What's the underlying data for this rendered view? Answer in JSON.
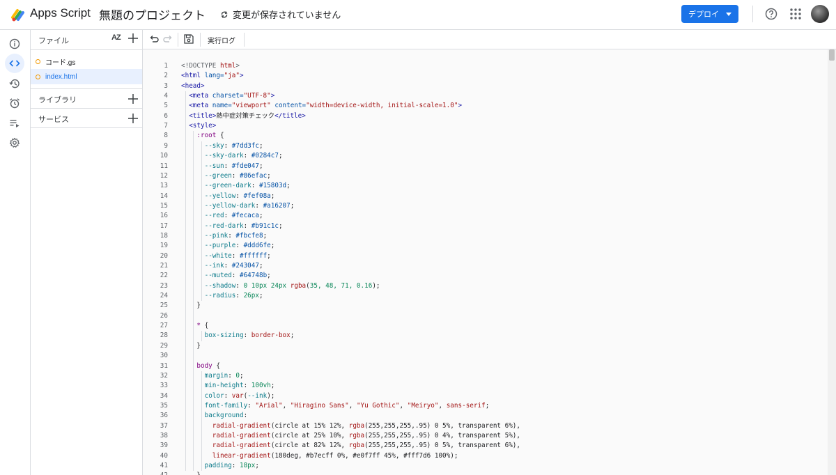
{
  "header": {
    "app_title": "Apps Script",
    "project_title": "無題のプロジェクト",
    "save_status": "変更が保存されていません",
    "deploy_label": "デプロイ"
  },
  "files_panel": {
    "title": "ファイル",
    "sort_label": "AZ",
    "files": [
      {
        "name": "コード.gs",
        "active": false
      },
      {
        "name": "index.html",
        "active": true
      }
    ],
    "sections": [
      {
        "label": "ライブラリ"
      },
      {
        "label": "サービス"
      }
    ]
  },
  "toolbar": {
    "run_log_label": "実行ログ"
  },
  "editor": {
    "lines": [
      {
        "n": "1",
        "indent": 0,
        "tokens": [
          [
            "t-gray",
            "<!DOCTYPE "
          ],
          [
            "t-str",
            "html"
          ],
          [
            "t-gray",
            ">"
          ]
        ]
      },
      {
        "n": "2",
        "indent": 0,
        "tokens": [
          [
            "t-tag",
            "<html "
          ],
          [
            "t-attr",
            "lang="
          ],
          [
            "t-str",
            "\"ja\""
          ],
          [
            "t-tag",
            ">"
          ]
        ]
      },
      {
        "n": "3",
        "indent": 0,
        "tokens": [
          [
            "t-tag",
            "<head>"
          ]
        ]
      },
      {
        "n": "4",
        "indent": 1,
        "tokens": [
          [
            "t-tag",
            "<meta "
          ],
          [
            "t-attr",
            "charset="
          ],
          [
            "t-str",
            "\"UTF-8\""
          ],
          [
            "t-tag",
            ">"
          ]
        ]
      },
      {
        "n": "5",
        "indent": 1,
        "tokens": [
          [
            "t-tag",
            "<meta "
          ],
          [
            "t-attr",
            "name="
          ],
          [
            "t-str",
            "\"viewport\""
          ],
          [
            "t-attr",
            " content="
          ],
          [
            "t-str",
            "\"width=device-width, initial-scale=1.0\""
          ],
          [
            "t-tag",
            ">"
          ]
        ]
      },
      {
        "n": "6",
        "indent": 1,
        "tokens": [
          [
            "t-tag",
            "<title>"
          ],
          [
            "",
            "熱中症対策チェック"
          ],
          [
            "t-tag",
            "</title>"
          ]
        ]
      },
      {
        "n": "7",
        "indent": 1,
        "tokens": [
          [
            "t-tag",
            "<style>"
          ]
        ]
      },
      {
        "n": "8",
        "indent": 2,
        "tokens": [
          [
            "t-sel",
            ":root "
          ],
          [
            "",
            "{"
          ]
        ]
      },
      {
        "n": "9",
        "indent": 3,
        "tokens": [
          [
            "t-prop",
            "--sky"
          ],
          [
            "",
            ": "
          ],
          [
            "t-attr",
            "#7dd3fc"
          ],
          [
            "",
            ";"
          ]
        ]
      },
      {
        "n": "10",
        "indent": 3,
        "tokens": [
          [
            "t-prop",
            "--sky-dark"
          ],
          [
            "",
            ": "
          ],
          [
            "t-attr",
            "#0284c7"
          ],
          [
            "",
            ";"
          ]
        ]
      },
      {
        "n": "11",
        "indent": 3,
        "tokens": [
          [
            "t-prop",
            "--sun"
          ],
          [
            "",
            ": "
          ],
          [
            "t-attr",
            "#fde047"
          ],
          [
            "",
            ";"
          ]
        ]
      },
      {
        "n": "12",
        "indent": 3,
        "tokens": [
          [
            "t-prop",
            "--green"
          ],
          [
            "",
            ": "
          ],
          [
            "t-attr",
            "#86efac"
          ],
          [
            "",
            ";"
          ]
        ]
      },
      {
        "n": "13",
        "indent": 3,
        "tokens": [
          [
            "t-prop",
            "--green-dark"
          ],
          [
            "",
            ": "
          ],
          [
            "t-attr",
            "#15803d"
          ],
          [
            "",
            ";"
          ]
        ]
      },
      {
        "n": "14",
        "indent": 3,
        "tokens": [
          [
            "t-prop",
            "--yellow"
          ],
          [
            "",
            ": "
          ],
          [
            "t-attr",
            "#fef08a"
          ],
          [
            "",
            ";"
          ]
        ]
      },
      {
        "n": "15",
        "indent": 3,
        "tokens": [
          [
            "t-prop",
            "--yellow-dark"
          ],
          [
            "",
            ": "
          ],
          [
            "t-attr",
            "#a16207"
          ],
          [
            "",
            ";"
          ]
        ]
      },
      {
        "n": "16",
        "indent": 3,
        "tokens": [
          [
            "t-prop",
            "--red"
          ],
          [
            "",
            ": "
          ],
          [
            "t-attr",
            "#fecaca"
          ],
          [
            "",
            ";"
          ]
        ]
      },
      {
        "n": "17",
        "indent": 3,
        "tokens": [
          [
            "t-prop",
            "--red-dark"
          ],
          [
            "",
            ": "
          ],
          [
            "t-attr",
            "#b91c1c"
          ],
          [
            "",
            ";"
          ]
        ]
      },
      {
        "n": "18",
        "indent": 3,
        "tokens": [
          [
            "t-prop",
            "--pink"
          ],
          [
            "",
            ": "
          ],
          [
            "t-attr",
            "#fbcfe8"
          ],
          [
            "",
            ";"
          ]
        ]
      },
      {
        "n": "19",
        "indent": 3,
        "tokens": [
          [
            "t-prop",
            "--purple"
          ],
          [
            "",
            ": "
          ],
          [
            "t-attr",
            "#ddd6fe"
          ],
          [
            "",
            ";"
          ]
        ]
      },
      {
        "n": "20",
        "indent": 3,
        "tokens": [
          [
            "t-prop",
            "--white"
          ],
          [
            "",
            ": "
          ],
          [
            "t-attr",
            "#ffffff"
          ],
          [
            "",
            ";"
          ]
        ]
      },
      {
        "n": "21",
        "indent": 3,
        "tokens": [
          [
            "t-prop",
            "--ink"
          ],
          [
            "",
            ": "
          ],
          [
            "t-attr",
            "#243047"
          ],
          [
            "",
            ";"
          ]
        ]
      },
      {
        "n": "22",
        "indent": 3,
        "tokens": [
          [
            "t-prop",
            "--muted"
          ],
          [
            "",
            ": "
          ],
          [
            "t-attr",
            "#64748b"
          ],
          [
            "",
            ";"
          ]
        ]
      },
      {
        "n": "23",
        "indent": 3,
        "tokens": [
          [
            "t-prop",
            "--shadow"
          ],
          [
            "",
            ": "
          ],
          [
            "t-num",
            "0 10px 24px "
          ],
          [
            "t-str",
            "rgba"
          ],
          [
            "",
            "("
          ],
          [
            "t-num",
            "35, 48, 71, 0.16"
          ],
          [
            "",
            ");"
          ]
        ]
      },
      {
        "n": "24",
        "indent": 3,
        "tokens": [
          [
            "t-prop",
            "--radius"
          ],
          [
            "",
            ": "
          ],
          [
            "t-num",
            "26px"
          ],
          [
            "",
            ";"
          ]
        ]
      },
      {
        "n": "25",
        "indent": 2,
        "tokens": [
          [
            "",
            "}"
          ]
        ]
      },
      {
        "n": "26",
        "indent": 0,
        "tokens": []
      },
      {
        "n": "27",
        "indent": 2,
        "tokens": [
          [
            "t-sel",
            "* "
          ],
          [
            "",
            "{"
          ]
        ]
      },
      {
        "n": "28",
        "indent": 3,
        "tokens": [
          [
            "t-prop",
            "box-sizing"
          ],
          [
            "",
            ": "
          ],
          [
            "t-str",
            "border-box"
          ],
          [
            "",
            ";"
          ]
        ]
      },
      {
        "n": "29",
        "indent": 2,
        "tokens": [
          [
            "",
            "}"
          ]
        ]
      },
      {
        "n": "30",
        "indent": 0,
        "tokens": []
      },
      {
        "n": "31",
        "indent": 2,
        "tokens": [
          [
            "t-sel",
            "body "
          ],
          [
            "",
            "{"
          ]
        ]
      },
      {
        "n": "32",
        "indent": 3,
        "tokens": [
          [
            "t-prop",
            "margin"
          ],
          [
            "",
            ": "
          ],
          [
            "t-num",
            "0"
          ],
          [
            "",
            ";"
          ]
        ]
      },
      {
        "n": "33",
        "indent": 3,
        "tokens": [
          [
            "t-prop",
            "min-height"
          ],
          [
            "",
            ": "
          ],
          [
            "t-num",
            "100vh"
          ],
          [
            "",
            ";"
          ]
        ]
      },
      {
        "n": "34",
        "indent": 3,
        "tokens": [
          [
            "t-prop",
            "color"
          ],
          [
            "",
            ": "
          ],
          [
            "t-str",
            "var"
          ],
          [
            "",
            "("
          ],
          [
            "t-prop",
            "--ink"
          ],
          [
            "",
            ");"
          ]
        ]
      },
      {
        "n": "35",
        "indent": 3,
        "tokens": [
          [
            "t-prop",
            "font-family"
          ],
          [
            "",
            ": "
          ],
          [
            "t-str",
            "\"Arial\""
          ],
          [
            "",
            ", "
          ],
          [
            "t-str",
            "\"Hiragino Sans\""
          ],
          [
            "",
            ", "
          ],
          [
            "t-str",
            "\"Yu Gothic\""
          ],
          [
            "",
            ", "
          ],
          [
            "t-str",
            "\"Meiryo\""
          ],
          [
            "",
            ", "
          ],
          [
            "t-str",
            "sans-serif"
          ],
          [
            "",
            ";"
          ]
        ]
      },
      {
        "n": "36",
        "indent": 3,
        "tokens": [
          [
            "t-prop",
            "background"
          ],
          [
            "",
            ":"
          ]
        ]
      },
      {
        "n": "37",
        "indent": 4,
        "tokens": [
          [
            "t-str",
            "radial-gradient"
          ],
          [
            "",
            "(circle at 15% 12%, "
          ],
          [
            "t-str",
            "rgba"
          ],
          [
            "",
            "(255,255,255,.95) 0 5%, transparent 6%),"
          ]
        ]
      },
      {
        "n": "38",
        "indent": 4,
        "tokens": [
          [
            "t-str",
            "radial-gradient"
          ],
          [
            "",
            "(circle at 25% 10%, "
          ],
          [
            "t-str",
            "rgba"
          ],
          [
            "",
            "(255,255,255,.95) 0 4%, transparent 5%),"
          ]
        ]
      },
      {
        "n": "39",
        "indent": 4,
        "tokens": [
          [
            "t-str",
            "radial-gradient"
          ],
          [
            "",
            "(circle at 82% 12%, "
          ],
          [
            "t-str",
            "rgba"
          ],
          [
            "",
            "(255,255,255,.95) 0 5%, transparent 6%),"
          ]
        ]
      },
      {
        "n": "40",
        "indent": 4,
        "tokens": [
          [
            "t-str",
            "linear-gradient"
          ],
          [
            "",
            "(180deg, #b7ecff 0%, #e0f7ff 45%, #fff7d6 100%);"
          ]
        ]
      },
      {
        "n": "41",
        "indent": 3,
        "tokens": [
          [
            "t-prop",
            "padding"
          ],
          [
            "",
            ": "
          ],
          [
            "t-num",
            "18px"
          ],
          [
            "",
            ";"
          ]
        ]
      },
      {
        "n": "42",
        "indent": 2,
        "tokens": [
          [
            "",
            "}"
          ]
        ]
      }
    ]
  },
  "colors": {
    "accent": "#1a73e8",
    "active_bg": "#e8f0fe",
    "file_dot": "#f29900"
  }
}
